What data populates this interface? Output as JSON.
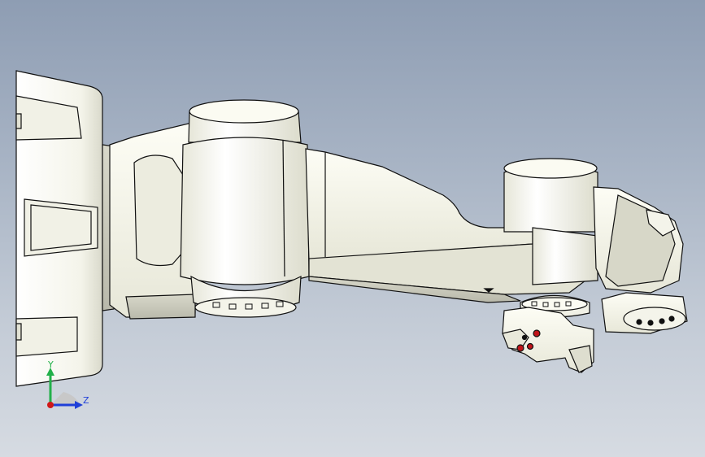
{
  "viewport": {
    "background_top": "#8e9db3",
    "background_bottom": "#d6dbe2",
    "part_fill": "#fbfbf2",
    "part_shade": "#e4e4d6",
    "edge_color": "#111111",
    "accent_red": "#c0141a"
  },
  "triad": {
    "y_label": "Y",
    "z_label": "Z",
    "y_color": "#22b04a",
    "z_color": "#1f3fd8",
    "origin_color": "#d01818"
  }
}
